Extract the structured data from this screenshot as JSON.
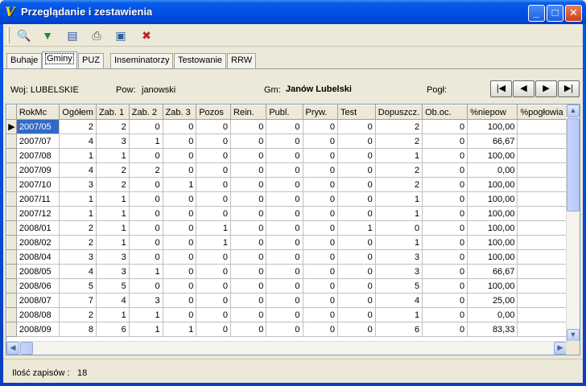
{
  "window": {
    "title": "Przeglądanie i zestawienia",
    "icon": "V"
  },
  "title_buttons": {
    "minimize": "_",
    "maximize": "□",
    "close": "✕"
  },
  "toolbar": [
    {
      "name": "search-tool-button",
      "glyph": "🔍"
    },
    {
      "name": "filter-tool-button",
      "glyph": "▼"
    },
    {
      "name": "list-tool-button",
      "glyph": "▤"
    },
    {
      "name": "print-tool-button",
      "glyph": "⎙"
    },
    {
      "name": "preview-tool-button",
      "glyph": "▣"
    },
    {
      "name": "close-view-tool-button",
      "glyph": "✖"
    }
  ],
  "tabs": [
    "Buhaje",
    "Gminy",
    "PUZ",
    "Inseminatorzy",
    "Testowanie",
    "RRW"
  ],
  "active_tab": 1,
  "info": {
    "woj": "Woj: LUBELSKIE",
    "pow_label": "Pow:",
    "pow_value": "janowski",
    "gm_label": "Gm:",
    "gm_value": "Janów Lubelski",
    "pogl_label": "Pogł:"
  },
  "nav": {
    "first": "|◀",
    "prev": "◀",
    "next": "▶",
    "last": "▶|"
  },
  "table": {
    "columns": [
      "RokMc",
      "Ogółem",
      "Zab. 1",
      "Zab. 2",
      "Zab. 3",
      "Pozos",
      "Rein.",
      "Publ.",
      "Pryw.",
      "Test",
      "Dopuszcz.",
      "Ob.oc.",
      "%niepow",
      "%pogłowia"
    ],
    "rows": [
      [
        "2007/05",
        "2",
        "2",
        "0",
        "0",
        "0",
        "0",
        "0",
        "0",
        "0",
        "2",
        "0",
        "100,00",
        ""
      ],
      [
        "2007/07",
        "4",
        "3",
        "1",
        "0",
        "0",
        "0",
        "0",
        "0",
        "0",
        "2",
        "0",
        "66,67",
        ""
      ],
      [
        "2007/08",
        "1",
        "1",
        "0",
        "0",
        "0",
        "0",
        "0",
        "0",
        "0",
        "1",
        "0",
        "100,00",
        ""
      ],
      [
        "2007/09",
        "4",
        "2",
        "2",
        "0",
        "0",
        "0",
        "0",
        "0",
        "0",
        "2",
        "0",
        "0,00",
        ""
      ],
      [
        "2007/10",
        "3",
        "2",
        "0",
        "1",
        "0",
        "0",
        "0",
        "0",
        "0",
        "2",
        "0",
        "100,00",
        ""
      ],
      [
        "2007/11",
        "1",
        "1",
        "0",
        "0",
        "0",
        "0",
        "0",
        "0",
        "0",
        "1",
        "0",
        "100,00",
        ""
      ],
      [
        "2007/12",
        "1",
        "1",
        "0",
        "0",
        "0",
        "0",
        "0",
        "0",
        "0",
        "1",
        "0",
        "100,00",
        ""
      ],
      [
        "2008/01",
        "2",
        "1",
        "0",
        "0",
        "1",
        "0",
        "0",
        "0",
        "1",
        "0",
        "0",
        "100,00",
        ""
      ],
      [
        "2008/02",
        "2",
        "1",
        "0",
        "0",
        "1",
        "0",
        "0",
        "0",
        "0",
        "1",
        "0",
        "100,00",
        ""
      ],
      [
        "2008/04",
        "3",
        "3",
        "0",
        "0",
        "0",
        "0",
        "0",
        "0",
        "0",
        "3",
        "0",
        "100,00",
        ""
      ],
      [
        "2008/05",
        "4",
        "3",
        "1",
        "0",
        "0",
        "0",
        "0",
        "0",
        "0",
        "3",
        "0",
        "66,67",
        ""
      ],
      [
        "2008/06",
        "5",
        "5",
        "0",
        "0",
        "0",
        "0",
        "0",
        "0",
        "0",
        "5",
        "0",
        "100,00",
        ""
      ],
      [
        "2008/07",
        "7",
        "4",
        "3",
        "0",
        "0",
        "0",
        "0",
        "0",
        "0",
        "4",
        "0",
        "25,00",
        ""
      ],
      [
        "2008/08",
        "2",
        "1",
        "1",
        "0",
        "0",
        "0",
        "0",
        "0",
        "0",
        "1",
        "0",
        "0,00",
        ""
      ],
      [
        "2008/09",
        "8",
        "6",
        "1",
        "1",
        "0",
        "0",
        "0",
        "0",
        "0",
        "6",
        "0",
        "83,33",
        ""
      ]
    ],
    "selected_row": 0,
    "row_indicator": "▶"
  },
  "status": {
    "label": "Ilość zapisów :",
    "count": "18"
  }
}
